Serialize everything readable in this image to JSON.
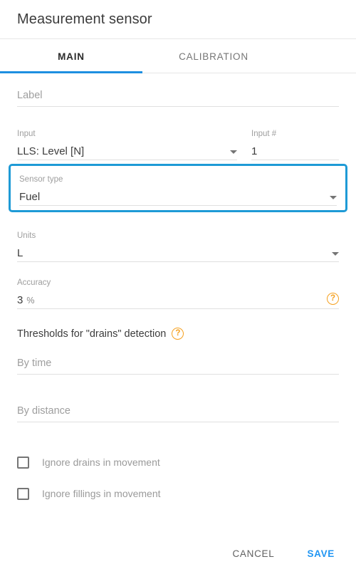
{
  "dialog": {
    "title": "Measurement sensor"
  },
  "tabs": [
    {
      "id": "main",
      "label": "MAIN",
      "active": true
    },
    {
      "id": "calibration",
      "label": "CALIBRATION",
      "active": false
    }
  ],
  "form": {
    "label_field": {
      "placeholder": "Label",
      "value": ""
    },
    "input_field": {
      "label": "Input",
      "value": "LLS: Level [N]"
    },
    "input_number_field": {
      "label": "Input #",
      "value": "1"
    },
    "sensor_type_field": {
      "label": "Sensor type",
      "value": "Fuel",
      "highlighted": true,
      "highlight_color": "#1e9ad6"
    },
    "units_field": {
      "label": "Units",
      "value": "L"
    },
    "accuracy_field": {
      "label": "Accuracy",
      "value": "3",
      "suffix": "%",
      "help": "?"
    },
    "thresholds_section": {
      "heading": "Thresholds for \"drains\" detection",
      "help": "?"
    },
    "by_time_field": {
      "placeholder": "By time",
      "value": ""
    },
    "by_distance_field": {
      "placeholder": "By distance",
      "value": ""
    },
    "checkboxes": [
      {
        "id": "ignore-drains",
        "label": "Ignore drains in movement",
        "checked": false
      },
      {
        "id": "ignore-fillings",
        "label": "Ignore fillings in movement",
        "checked": false
      }
    ]
  },
  "footer": {
    "cancel_label": "CANCEL",
    "save_label": "SAVE"
  },
  "colors": {
    "accent_blue": "#1e8fe0",
    "highlight_blue": "#1e9ad6",
    "save_blue": "#2196f3",
    "help_orange": "#f5a01e"
  }
}
